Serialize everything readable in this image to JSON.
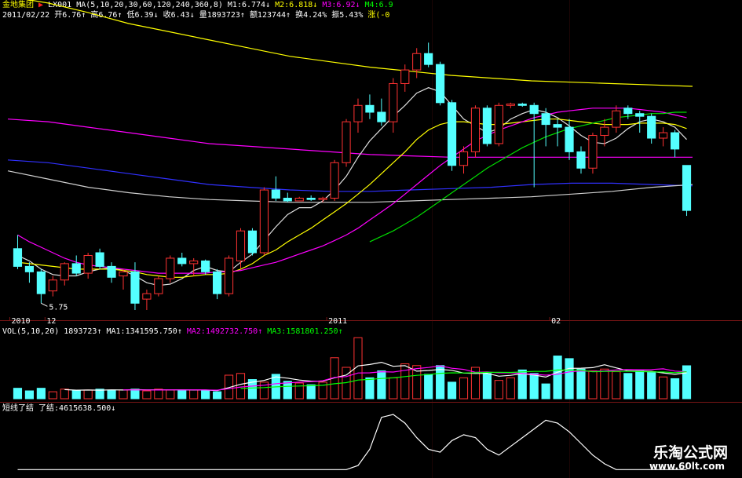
{
  "header": {
    "stock_name": "金地集团",
    "indicator_name": "LX001",
    "ma_params": "MA(5,10,20,30,60,120,240,360,8)",
    "ma_values": [
      {
        "label": "M1:6.774",
        "color": "#ffffff",
        "arrow": "↓"
      },
      {
        "label": "M2:6.818",
        "color": "#ffff00",
        "arrow": "↓"
      },
      {
        "label": "M3:6.92",
        "color": "#ff00ff",
        "arrow": "↓"
      },
      {
        "label": "M4:6.9",
        "color": "#00ff00",
        "arrow": ""
      }
    ],
    "date": "2011/02/22",
    "stats": [
      {
        "label": "开6.76",
        "arrow": "↑",
        "color": "#ffffff"
      },
      {
        "label": "高6.76",
        "arrow": "↑",
        "color": "#ffffff"
      },
      {
        "label": "低6.39",
        "arrow": "↓",
        "color": "#ffffff"
      },
      {
        "label": "收6.43",
        "arrow": "↓",
        "color": "#ffffff"
      },
      {
        "label": "量1893723",
        "arrow": "↑",
        "color": "#ffffff"
      },
      {
        "label": "额123744",
        "arrow": "↑",
        "color": "#ffffff"
      },
      {
        "label": "换4.24%",
        "arrow": "",
        "color": "#ffffff"
      },
      {
        "label": "振5.43%",
        "arrow": "",
        "color": "#ffffff"
      },
      {
        "label": "涨(-0",
        "arrow": "",
        "color": "#ffff00"
      }
    ]
  },
  "vol_header": {
    "title": "VOL(5,10,20)",
    "value": "1893723",
    "ma1": "MA1:1341595.750",
    "ma2": "MA2:1492732.750",
    "ma3": "MA3:1581801.250",
    "colors": {
      "value": "#ffffff",
      "ma1": "#ffffff",
      "ma2": "#ff00ff",
      "ma3": "#00ff00"
    }
  },
  "ind_header": {
    "title": "短线了结",
    "value": "了结:4615638.500",
    "arrow": "↓"
  },
  "watermark": {
    "line1": "乐淘公式网",
    "line2": "www.60lt.com"
  },
  "colors": {
    "up": "#ff3232",
    "down": "#54ffff",
    "separator": "#7a1515",
    "text": "#ffffff"
  },
  "chart_data": {
    "type": "candlestick",
    "x_labels": [
      {
        "text": "2010",
        "index": 0
      },
      {
        "text": "12",
        "index": 3
      },
      {
        "text": "2011",
        "index": 27
      },
      {
        "text": "02",
        "index": 46
      }
    ],
    "annotations": [
      {
        "text": "5.75",
        "index": 2,
        "kind": "low"
      }
    ],
    "candles": [
      [
        6.15,
        6.25,
        6.0,
        6.02
      ],
      [
        6.02,
        6.05,
        5.9,
        5.98
      ],
      [
        5.98,
        6.0,
        5.75,
        5.82
      ],
      [
        5.84,
        5.95,
        5.8,
        5.92
      ],
      [
        5.92,
        6.05,
        5.88,
        6.04
      ],
      [
        6.04,
        6.1,
        5.95,
        5.97
      ],
      [
        5.97,
        6.12,
        5.93,
        6.1
      ],
      [
        6.12,
        6.15,
        6.0,
        6.02
      ],
      [
        6.02,
        6.05,
        5.9,
        5.94
      ],
      [
        5.95,
        6.0,
        5.85,
        5.98
      ],
      [
        5.98,
        6.05,
        5.7,
        5.75
      ],
      [
        5.78,
        5.85,
        5.7,
        5.82
      ],
      [
        5.82,
        5.95,
        5.8,
        5.93
      ],
      [
        5.93,
        6.1,
        5.9,
        6.08
      ],
      [
        6.08,
        6.12,
        6.02,
        6.04
      ],
      [
        6.04,
        6.08,
        5.95,
        6.06
      ],
      [
        6.06,
        6.07,
        5.96,
        5.98
      ],
      [
        5.98,
        6.0,
        5.78,
        5.82
      ],
      [
        5.82,
        6.1,
        5.8,
        6.08
      ],
      [
        6.06,
        6.3,
        6.0,
        6.28
      ],
      [
        6.28,
        6.3,
        6.1,
        6.12
      ],
      [
        6.12,
        6.6,
        6.1,
        6.58
      ],
      [
        6.58,
        6.68,
        6.5,
        6.52
      ],
      [
        6.52,
        6.56,
        6.49,
        6.5
      ],
      [
        6.5,
        6.53,
        6.5,
        6.52
      ],
      [
        6.52,
        6.54,
        6.5,
        6.51
      ],
      [
        6.51,
        6.53,
        6.49,
        6.52
      ],
      [
        6.52,
        6.8,
        6.5,
        6.78
      ],
      [
        6.78,
        7.1,
        6.75,
        7.08
      ],
      [
        7.08,
        7.25,
        7.0,
        7.2
      ],
      [
        7.2,
        7.28,
        7.1,
        7.15
      ],
      [
        7.15,
        7.25,
        7.05,
        7.08
      ],
      [
        7.08,
        7.4,
        7.0,
        7.36
      ],
      [
        7.36,
        7.5,
        7.3,
        7.46
      ],
      [
        7.46,
        7.62,
        7.4,
        7.58
      ],
      [
        7.58,
        7.66,
        7.48,
        7.5
      ],
      [
        7.5,
        7.52,
        7.2,
        7.22
      ],
      [
        7.22,
        7.24,
        6.72,
        6.76
      ],
      [
        6.76,
        6.9,
        6.7,
        6.86
      ],
      [
        6.86,
        7.2,
        6.82,
        7.18
      ],
      [
        7.18,
        7.2,
        6.9,
        6.92
      ],
      [
        6.92,
        7.22,
        6.9,
        7.2
      ],
      [
        7.2,
        7.22,
        7.18,
        7.21
      ],
      [
        7.21,
        7.22,
        7.19,
        7.2
      ],
      [
        7.2,
        7.22,
        6.6,
        7.14
      ],
      [
        7.14,
        7.18,
        6.9,
        7.06
      ],
      [
        7.06,
        7.1,
        6.9,
        7.04
      ],
      [
        7.04,
        7.1,
        6.8,
        6.86
      ],
      [
        6.86,
        6.9,
        6.7,
        6.74
      ],
      [
        6.74,
        7.0,
        6.7,
        6.98
      ],
      [
        6.98,
        7.1,
        6.9,
        7.04
      ],
      [
        7.04,
        7.2,
        7.0,
        7.16
      ],
      [
        7.18,
        7.2,
        7.1,
        7.14
      ],
      [
        7.14,
        7.16,
        7.0,
        7.12
      ],
      [
        7.12,
        7.14,
        6.92,
        6.96
      ],
      [
        6.96,
        7.04,
        6.9,
        7.0
      ],
      [
        7.0,
        7.02,
        6.82,
        6.88
      ],
      [
        6.76,
        6.76,
        6.39,
        6.43
      ]
    ],
    "volumes": [
      0.6,
      0.45,
      0.6,
      0.4,
      0.55,
      0.45,
      0.5,
      0.55,
      0.5,
      0.5,
      0.55,
      0.45,
      0.55,
      0.5,
      0.5,
      0.5,
      0.45,
      0.4,
      1.35,
      1.45,
      1.1,
      0.95,
      1.4,
      1.0,
      0.9,
      0.8,
      0.95,
      2.35,
      1.8,
      3.5,
      1.2,
      1.6,
      1.2,
      2.0,
      1.9,
      1.4,
      1.9,
      0.95,
      1.2,
      1.8,
      1.45,
      1.05,
      1.2,
      1.65,
      1.45,
      0.85,
      2.45,
      2.3,
      1.7,
      1.6,
      1.7,
      1.55,
      1.45,
      1.6,
      1.55,
      1.25,
      1.15,
      1.89
    ],
    "lines": [
      {
        "name": "M1",
        "color": "#e0e0e0",
        "values": [
          6.1,
          6.06,
          6.0,
          5.96,
          5.95,
          5.95,
          5.98,
          6.0,
          6.01,
          5.99,
          5.95,
          5.9,
          5.88,
          5.89,
          5.93,
          5.99,
          6.02,
          5.99,
          5.98,
          6.05,
          6.11,
          6.21,
          6.31,
          6.4,
          6.45,
          6.45,
          6.5,
          6.58,
          6.68,
          6.82,
          6.94,
          7.03,
          7.12,
          7.2,
          7.29,
          7.33,
          7.3,
          7.2,
          7.1,
          7.05,
          7.0,
          7.03,
          7.1,
          7.14,
          7.17,
          7.15,
          7.11,
          7.05,
          6.98,
          6.93,
          6.92,
          6.96,
          7.03,
          7.08,
          7.1,
          7.08,
          7.04,
          6.95
        ]
      },
      {
        "name": "M2",
        "color": "#ffff00",
        "values": [
          6.05,
          6.04,
          6.03,
          6.02,
          6.01,
          6.0,
          6.0,
          6.0,
          6.0,
          5.99,
          5.98,
          5.96,
          5.95,
          5.94,
          5.94,
          5.95,
          5.96,
          5.96,
          5.97,
          6.0,
          6.04,
          6.1,
          6.14,
          6.2,
          6.25,
          6.3,
          6.36,
          6.42,
          6.48,
          6.55,
          6.62,
          6.7,
          6.78,
          6.86,
          6.95,
          7.02,
          7.06,
          7.08,
          7.08,
          7.07,
          7.06,
          7.06,
          7.07,
          7.08,
          7.09,
          7.1,
          7.1,
          7.09,
          7.08,
          7.07,
          7.06,
          7.06,
          7.06,
          7.07,
          7.07,
          7.07,
          7.06,
          7.03
        ]
      },
      {
        "name": "M3",
        "color": "#ff00ff",
        "values": [
          6.25,
          6.2,
          6.16,
          6.12,
          6.08,
          6.05,
          6.03,
          6.02,
          6.01,
          6.0,
          5.99,
          5.98,
          5.97,
          5.97,
          5.97,
          5.97,
          5.97,
          5.98,
          5.98,
          5.99,
          6.01,
          6.03,
          6.05,
          6.08,
          6.11,
          6.14,
          6.17,
          6.21,
          6.25,
          6.3,
          6.36,
          6.42,
          6.48,
          6.55,
          6.62,
          6.69,
          6.76,
          6.82,
          6.88,
          6.94,
          6.98,
          7.02,
          7.05,
          7.08,
          7.11,
          7.13,
          7.15,
          7.16,
          7.17,
          7.18,
          7.18,
          7.18,
          7.18,
          7.17,
          7.16,
          7.15,
          7.13,
          7.11
        ]
      },
      {
        "name": "M4",
        "color": "#00dd00",
        "values": [
          null,
          null,
          null,
          null,
          null,
          null,
          null,
          null,
          null,
          null,
          null,
          null,
          null,
          null,
          null,
          null,
          null,
          null,
          null,
          null,
          null,
          null,
          null,
          null,
          null,
          null,
          null,
          null,
          null,
          null,
          6.2,
          6.24,
          6.28,
          6.33,
          6.38,
          6.44,
          6.5,
          6.56,
          6.62,
          6.68,
          6.74,
          6.79,
          6.84,
          6.89,
          6.93,
          6.97,
          7.0,
          7.03,
          7.05,
          7.07,
          7.09,
          7.11,
          7.12,
          7.13,
          7.14,
          7.14,
          7.15,
          7.15
        ]
      }
    ],
    "long_lines": [
      {
        "name": "MA120",
        "color": "#ffff00",
        "values": [
          8.0,
          7.95,
          7.88,
          7.8,
          7.74,
          7.68,
          7.62,
          7.56,
          7.52,
          7.48,
          7.45,
          7.42,
          7.4,
          7.38,
          7.37,
          7.36,
          7.35,
          7.34
        ]
      },
      {
        "name": "MA240",
        "color": "#ff00ff",
        "values": [
          7.1,
          7.08,
          7.04,
          7.0,
          6.96,
          6.92,
          6.9,
          6.88,
          6.86,
          6.84,
          6.83,
          6.82,
          6.82,
          6.82,
          6.82,
          6.82,
          6.82,
          6.82
        ]
      },
      {
        "name": "MA360",
        "color": "#3030ff",
        "values": [
          6.8,
          6.78,
          6.74,
          6.7,
          6.66,
          6.62,
          6.6,
          6.58,
          6.57,
          6.57,
          6.58,
          6.59,
          6.6,
          6.62,
          6.63,
          6.63,
          6.62,
          6.61
        ]
      },
      {
        "name": "MA8",
        "color": "#d0d0d0",
        "values": [
          6.72,
          6.66,
          6.6,
          6.56,
          6.53,
          6.51,
          6.5,
          6.49,
          6.49,
          6.49,
          6.5,
          6.51,
          6.52,
          6.53,
          6.55,
          6.57,
          6.6,
          6.62
        ]
      }
    ],
    "indicator": [
      5,
      5,
      5,
      5,
      5,
      5,
      5,
      5,
      5,
      5,
      5,
      5,
      5,
      5,
      5,
      5,
      5,
      5,
      5,
      5,
      5,
      5,
      5,
      5,
      5,
      5,
      5,
      5,
      5,
      12,
      40,
      95,
      100,
      85,
      60,
      40,
      35,
      55,
      65,
      60,
      40,
      30,
      45,
      60,
      75,
      90,
      85,
      70,
      50,
      30,
      15,
      5,
      5,
      5,
      5,
      5,
      5,
      5
    ],
    "ylim": [
      5.7,
      7.8
    ]
  }
}
